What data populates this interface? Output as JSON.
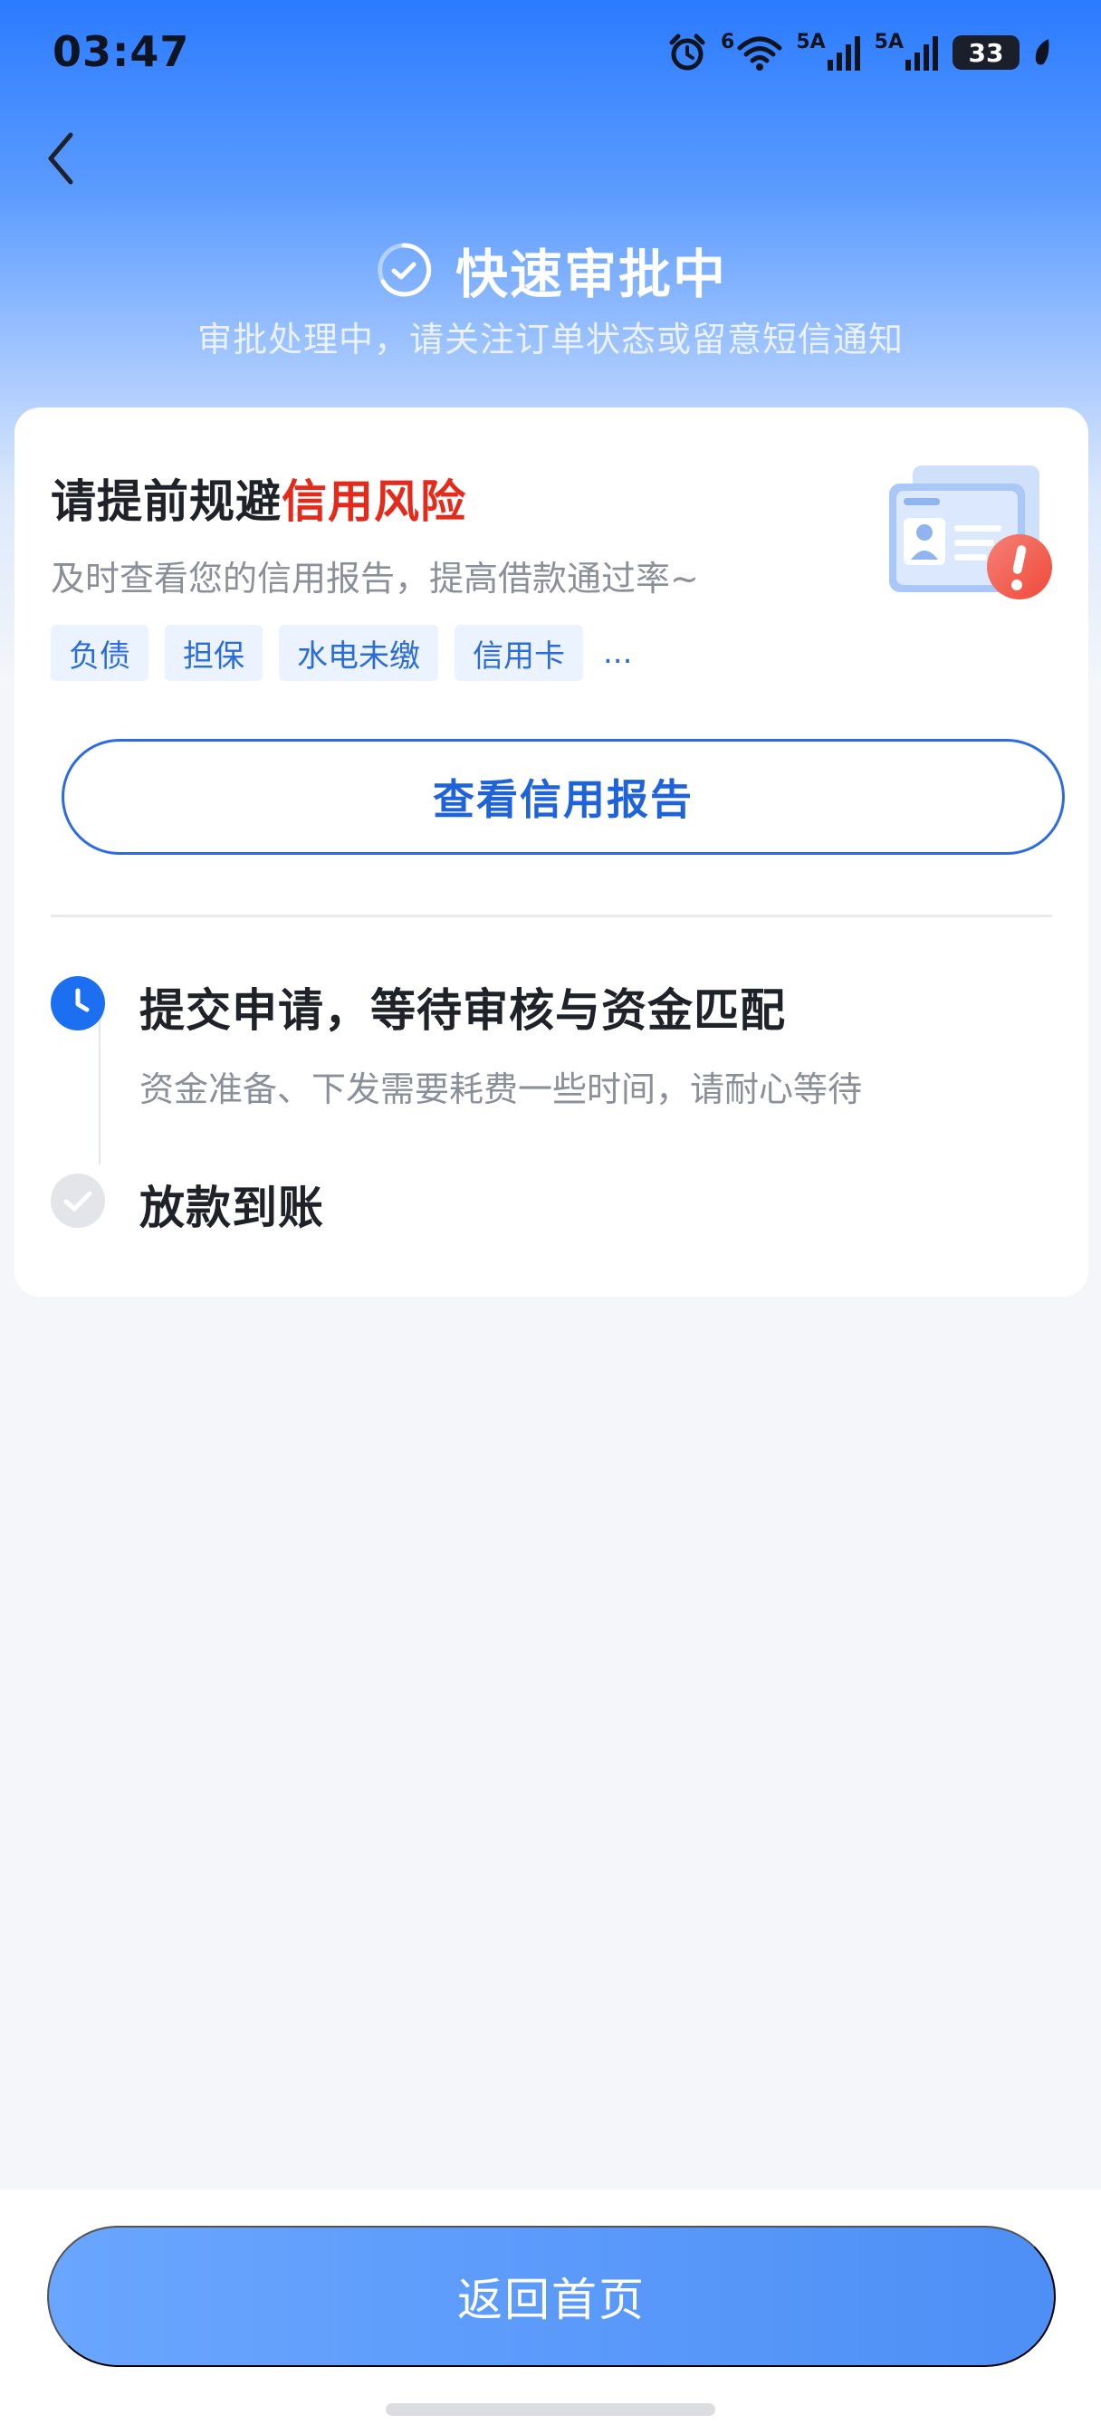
{
  "status_bar": {
    "time": "03:47",
    "signal1_label": "5A",
    "signal2_label": "5A",
    "wifi_label": "6",
    "battery": "33",
    "icons": [
      "alarm-icon",
      "wifi-icon",
      "signal-icon",
      "signal-icon",
      "battery-icon",
      "leaf-icon"
    ]
  },
  "header": {
    "back_icon": "chevron-left-icon",
    "title": "快速审批中",
    "subtitle": "审批处理中，请关注订单状态或留意短信通知"
  },
  "risk_card": {
    "title_prefix": "请提前规避",
    "title_highlight": "信用风险",
    "description": "及时查看您的信用报告，提高借款通过率~",
    "tags": [
      "负债",
      "担保",
      "水电未缴",
      "信用卡"
    ],
    "tags_more": "...",
    "button_label": "查看信用报告",
    "accent_color": "#e42a1b"
  },
  "timeline": {
    "steps": [
      {
        "title": "提交申请，等待审核与资金匹配",
        "description": "资金准备、下发需要耗费一些时间，请耐心等待",
        "status": "active",
        "icon": "clock-icon"
      },
      {
        "title": "放款到账",
        "status": "pending",
        "icon": "check-icon"
      }
    ]
  },
  "footer": {
    "home_button_label": "返回首页"
  }
}
